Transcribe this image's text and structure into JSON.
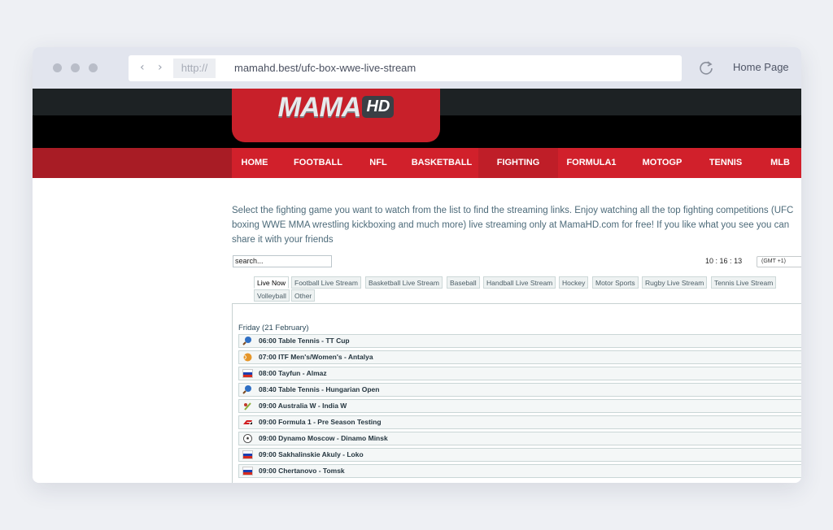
{
  "browser": {
    "protocol": "http://",
    "url": "mamahd.best/ufc-box-wwe-live-stream",
    "home_label": "Home Page"
  },
  "site": {
    "logo_text": "MAMA",
    "logo_suffix": "HD",
    "nav": [
      "HOME",
      "FOOTBALL",
      "NFL",
      "BASKETBALL",
      "FIGHTING",
      "FORMULA1",
      "MOTOGP",
      "TENNIS",
      "MLB"
    ],
    "active_nav": "FIGHTING",
    "intro_lines": [
      "Select the fighting game you want to watch from the list to find the streaming links. Enjoy watching all the top fighting competitions (UFC",
      "boxing WWE MMA wrestling kickboxing and much more) live streaming only at MamaHD.com for free! If you like what you see you can",
      "share it with your friends"
    ],
    "search_placeholder": "search...",
    "clock": {
      "h": "10",
      "m": "16",
      "s": "13"
    },
    "timezone": "(GMT +1)",
    "tabs": [
      "Live Now",
      "Football Live Stream",
      "Basketball Live Stream",
      "Baseball",
      "Handball Live Stream",
      "Hockey",
      "Motor Sports",
      "Rugby Live Stream",
      "Tennis Live Stream",
      "Volleyball",
      "Other"
    ],
    "active_tab": "Live Now",
    "day_header": "Friday (21 February)",
    "events": [
      {
        "icon": "table-tennis-icon",
        "text": "06:00  Table Tennis - TT Cup"
      },
      {
        "icon": "tennis-ball-icon",
        "text": "07:00  ITF Men's/Women's - Antalya"
      },
      {
        "icon": "russia-flag-icon",
        "text": "08:00  Tayfun - Almaz"
      },
      {
        "icon": "table-tennis-icon",
        "text": "08:40  Table Tennis - Hungarian Open"
      },
      {
        "icon": "cricket-icon",
        "text": "09:00  Australia W - India W"
      },
      {
        "icon": "formula1-icon",
        "text": "09:00  Formula 1 - Pre Season Testing"
      },
      {
        "icon": "soccer-ball-icon",
        "text": "09:00  Dynamo Moscow - Dinamo Minsk"
      },
      {
        "icon": "russia-flag-icon",
        "text": "09:00  Sakhalinskie Akuly - Loko"
      },
      {
        "icon": "russia-flag-icon",
        "text": "09:00  Chertanovo - Tomsk"
      }
    ]
  },
  "colors": {
    "brand_red": "#d1202b",
    "dark_header": "#1d2224",
    "intro_text": "#4d6b7a"
  }
}
